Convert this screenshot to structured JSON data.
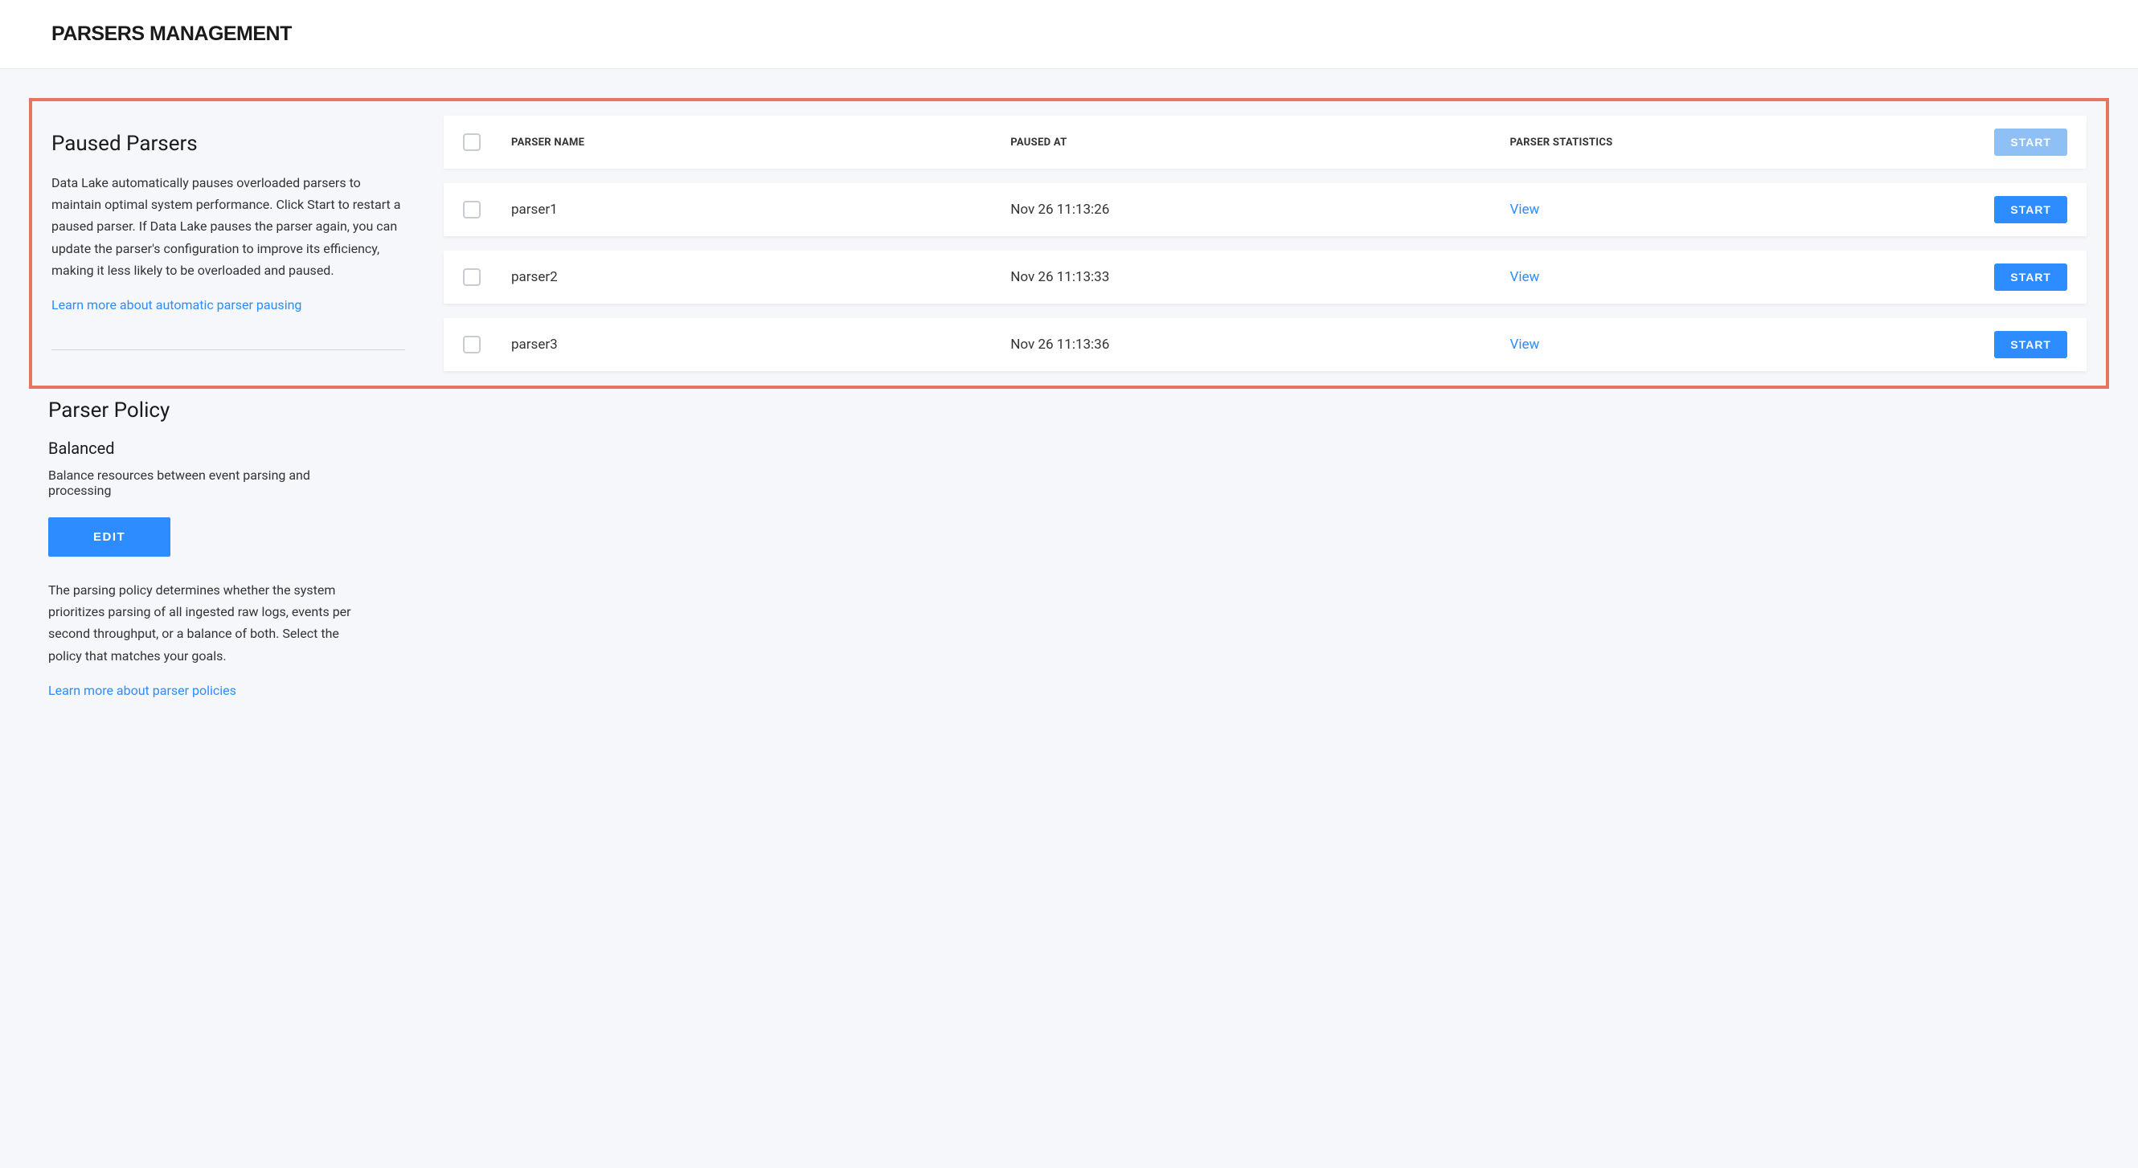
{
  "header": {
    "title": "PARSERS MANAGEMENT"
  },
  "paused_parsers": {
    "heading": "Paused Parsers",
    "description": "Data Lake automatically pauses overloaded parsers to maintain optimal system performance. Click Start to restart a paused parser. If Data Lake pauses the parser again, you can update the parser's configuration to improve its efficiency, making it less likely to be overloaded and paused.",
    "learn_more": "Learn more about automatic parser pausing"
  },
  "table": {
    "columns": {
      "parser_name": "PARSER NAME",
      "paused_at": "PAUSED AT",
      "parser_statistics": "PARSER STATISTICS"
    },
    "start_all_label": "START",
    "view_label": "View",
    "start_label": "START",
    "rows": [
      {
        "name": "parser1",
        "paused_at": "Nov 26 11:13:26"
      },
      {
        "name": "parser2",
        "paused_at": "Nov 26 11:13:33"
      },
      {
        "name": "parser3",
        "paused_at": "Nov 26 11:13:36"
      }
    ]
  },
  "policy": {
    "heading": "Parser Policy",
    "name": "Balanced",
    "summary": "Balance resources between event parsing and processing",
    "edit_label": "EDIT",
    "description": "The parsing policy determines whether the system prioritizes parsing of all ingested raw logs, events per second throughput, or a balance of both. Select the policy that matches your goals.",
    "learn_more": "Learn more about parser policies"
  }
}
